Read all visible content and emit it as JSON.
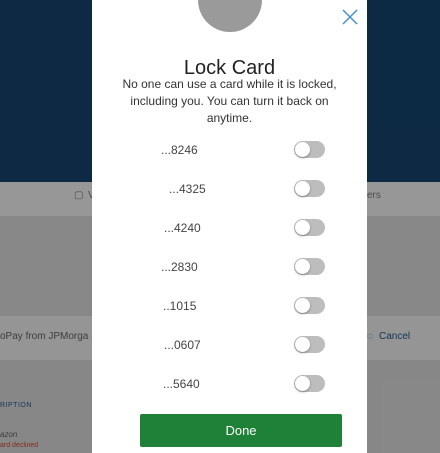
{
  "background": {
    "tabs": [
      "V",
      "ers"
    ],
    "autopay_text": "oPay from JPMorga",
    "cancel_label": "Cancel",
    "table_header": "RIPTION",
    "row_desc": "azon",
    "row_status": "ard declined"
  },
  "modal": {
    "title": "Lock Card",
    "description": "No one can use a card while it is locked, including you. You can turn it back on anytime.",
    "cards": [
      {
        "label": "...8246",
        "locked": false
      },
      {
        "label": "...4325",
        "locked": false
      },
      {
        "label": "...4240",
        "locked": false
      },
      {
        "label": "...2830",
        "locked": false
      },
      {
        "label": "..1015",
        "locked": false
      },
      {
        "label": "...0607",
        "locked": false
      },
      {
        "label": "...5640",
        "locked": false
      }
    ],
    "done_label": "Done"
  },
  "colors": {
    "primary_button": "#1e8137",
    "toggle_off": "#bdbdbd",
    "close_icon": "#4a90c8"
  }
}
